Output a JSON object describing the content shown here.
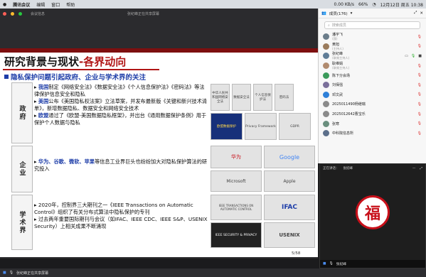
{
  "menubar": {
    "app": "腾讯会议",
    "items": [
      "编辑",
      "窗口",
      "帮助"
    ],
    "battery": "66%",
    "speed": "0.00 KB/s",
    "datetime": "12月12日 周五 10:38"
  },
  "titlebar": {
    "sharer": "张纪峰正在共享屏幕",
    "info": "会议信息"
  },
  "slide": {
    "title_main": "研究背景与现状",
    "title_sub": "-各界动向",
    "section": "隐私保护问题引起政府、企业与学术界的关注",
    "rows": [
      {
        "label": "政府",
        "items": [
          {
            "hl": "我国",
            "text": "制定《网络安全法》《数据安全法》《个人信息保护法》《密码法》等法律保护信息安全和隐私"
          },
          {
            "hl": "美国",
            "text": "公布《美国隐私权法案》立法草案，并发布最新版《关键和新兴技术清单》，新增数据隐私、数据安全和网络安全技术"
          },
          {
            "hl": "欧盟",
            "text": "通过了《欧盟-美国数据隐私框架》，并出台《通用数据保护条例》用于保护个人数据与隐私"
          }
        ],
        "images": [
          "中华人民共和国网络安全法",
          "数据安全法",
          "个人信息保护法",
          "密码法",
          "欧盟数据保护",
          "Privacy Framework",
          "GDPR"
        ]
      },
      {
        "label": "企业",
        "items": [
          {
            "hl": "华为、谷歌、微软、苹果",
            "text": "等信息工业界巨头也纷纷加大对隐私保护算法的研究投入"
          }
        ],
        "images": [
          "华为",
          "Google",
          "Microsoft",
          "Apple"
        ]
      },
      {
        "label": "学术界",
        "items": [
          {
            "hl": "",
            "text": "2020年，控制界三大期刊之一《IEEE Transactions on Automatic Control》组织了有关分布式算法中隐私保护的专刊"
          },
          {
            "hl": "",
            "text": "过去两年重要国际期刊与会议（如IFAC、IEEE CDC、IEEE S&P、USENIX Security）上相关成果不断涌现"
          }
        ],
        "images": [
          "IEEE TRANSACTIONS ON AUTOMATIC CONTROL",
          "IFAC",
          "IEEE SECURITY & PRIVACY",
          "USENIX"
        ]
      }
    ],
    "page": "5/58"
  },
  "sidebar": {
    "title": "成员(176)",
    "search_placeholder": "搜索成员",
    "members": [
      {
        "name": "潘宇飞",
        "note": "(我)"
      },
      {
        "name": "黄旭",
        "note": "(主持人)"
      },
      {
        "name": "张纪峰",
        "note": "(联席主持人)"
      },
      {
        "name": "耿维娟",
        "note": "(联席主持人)"
      },
      {
        "name": "陈下分会场",
        "note": ""
      },
      {
        "name": "刘保强",
        "note": ""
      },
      {
        "name": "邓文武",
        "note": ""
      },
      {
        "name": "2025011490杨继瑞",
        "note": ""
      },
      {
        "name": "2025012642曹宝乐",
        "note": ""
      },
      {
        "name": "张寒",
        "note": ""
      },
      {
        "name": "中科院信息所",
        "note": ""
      }
    ]
  },
  "video": {
    "label": "正在讲话：",
    "speaker": "张纪峰",
    "name_tag": "张纪峰"
  },
  "bottombar": {
    "text": "张纪峰正在共享屏幕"
  },
  "colors": {
    "accent_blue": "#1d3da8",
    "accent_red": "#b01515"
  }
}
